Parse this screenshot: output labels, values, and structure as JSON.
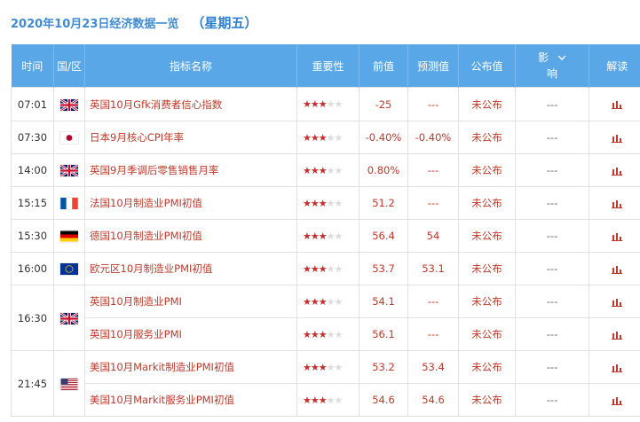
{
  "header": {
    "date": "2020年10月23日经济数据一览",
    "weekday": "（星期五）"
  },
  "columns": {
    "time": "时间",
    "region": "国/区",
    "indicator": "指标名称",
    "importance": "重要性",
    "previous": "前值",
    "forecast": "预测值",
    "published": "公布值",
    "impact_top": "影",
    "impact_bottom": "响",
    "analysis": "解读"
  },
  "rows": [
    {
      "time": "07:01",
      "flag": "uk-flag-icon",
      "name": "英国10月Gfk消费者信心指数",
      "stars": 3,
      "previous": "-25",
      "forecast": "---",
      "published": "未公布",
      "impact": "---"
    },
    {
      "time": "07:30",
      "flag": "japan-flag-icon",
      "name": "日本9月核心CPI年率",
      "stars": 3,
      "previous": "-0.40%",
      "forecast": "-0.40%",
      "published": "未公布",
      "impact": "---"
    },
    {
      "time": "14:00",
      "flag": "uk-flag-icon",
      "name": "英国9月季调后零售销售月率",
      "stars": 3,
      "previous": "0.80%",
      "forecast": "---",
      "published": "未公布",
      "impact": "---"
    },
    {
      "time": "15:15",
      "flag": "france-flag-icon",
      "name": "法国10月制造业PMI初值",
      "stars": 3,
      "previous": "51.2",
      "forecast": "---",
      "published": "未公布",
      "impact": "---"
    },
    {
      "time": "15:30",
      "flag": "germany-flag-icon",
      "name": "德国10月制造业PMI初值",
      "stars": 3,
      "previous": "56.4",
      "forecast": "54",
      "published": "未公布",
      "impact": "---"
    },
    {
      "time": "16:00",
      "flag": "eu-flag-icon",
      "name": "欧元区10月制造业PMI初值",
      "stars": 3,
      "previous": "53.7",
      "forecast": "53.1",
      "published": "未公布",
      "impact": "---"
    },
    {
      "time": "16:30",
      "flag": "uk-flag-icon",
      "name": "英国10月制造业PMI",
      "stars": 3,
      "previous": "54.1",
      "forecast": "---",
      "published": "未公布",
      "impact": "---"
    },
    {
      "time": "",
      "flag": "",
      "name": "英国10月服务业PMI",
      "stars": 3,
      "previous": "56.1",
      "forecast": "---",
      "published": "未公布",
      "impact": "---"
    },
    {
      "time": "21:45",
      "flag": "us-flag-icon",
      "name": "美国10月Markit制造业PMI初值",
      "stars": 3,
      "previous": "53.2",
      "forecast": "53.4",
      "published": "未公布",
      "impact": "---"
    },
    {
      "time": "",
      "flag": "",
      "name": "美国10月Markit服务业PMI初值",
      "stars": 3,
      "previous": "54.6",
      "forecast": "54.6",
      "published": "未公布",
      "impact": "---"
    }
  ],
  "colors": {
    "header_bg": "#5aa7e8",
    "accent_red": "#c0392b",
    "title_blue": "#3f8bd4"
  }
}
